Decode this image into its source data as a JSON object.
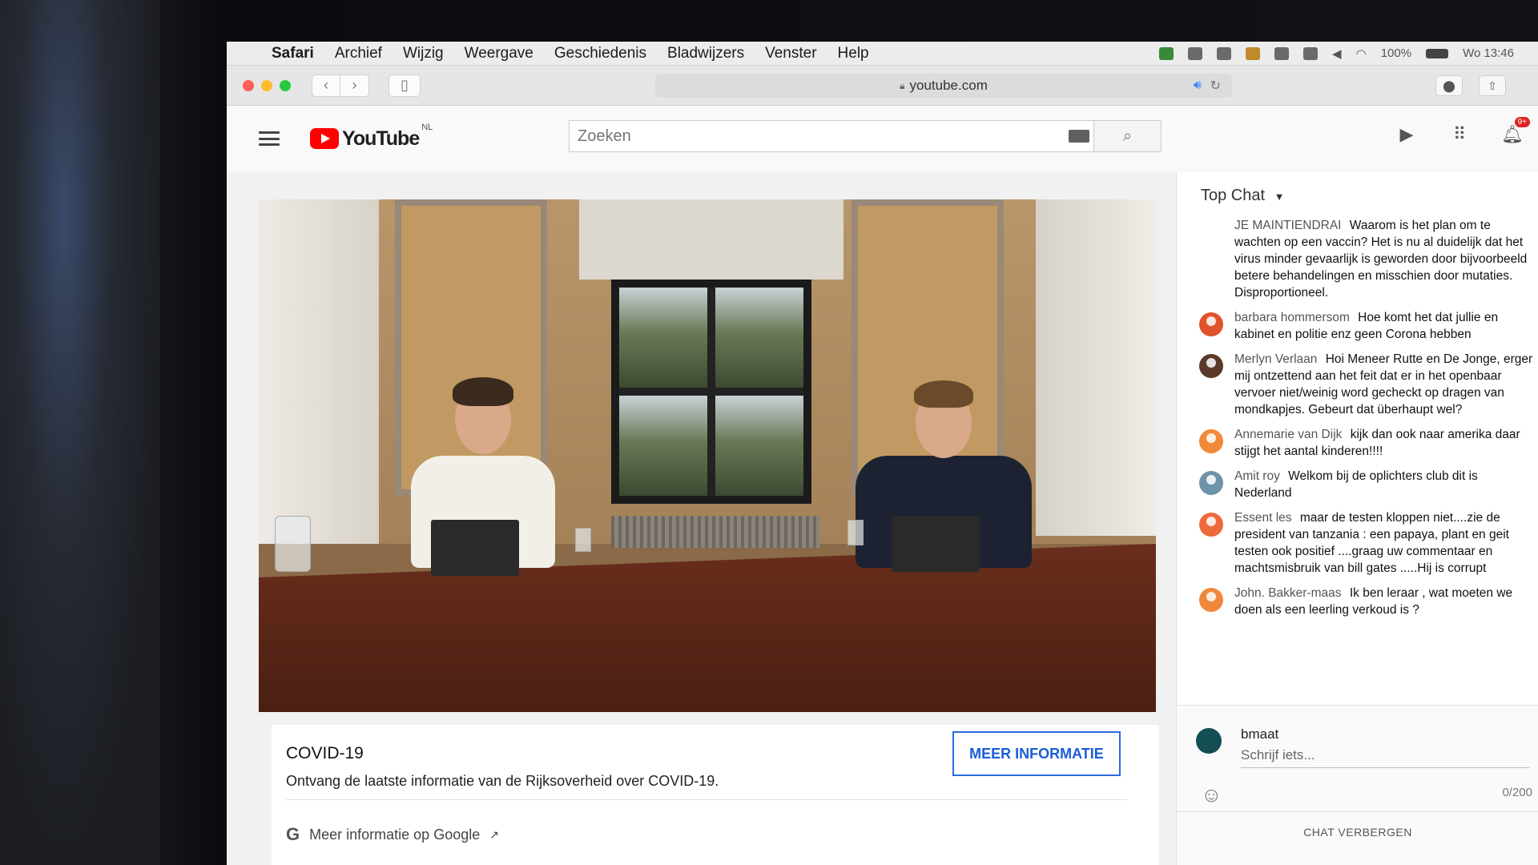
{
  "menubar": {
    "app": "Safari",
    "items": [
      "Archief",
      "Wijzig",
      "Weergave",
      "Geschiedenis",
      "Bladwijzers",
      "Venster",
      "Help"
    ],
    "battery": "100%",
    "clock": "Wo 13:46"
  },
  "toolbar": {
    "url": "youtube.com"
  },
  "youtube": {
    "logo_text": "YouTube",
    "region": "NL",
    "search_placeholder": "Zoeken",
    "notification_count": "9+"
  },
  "info_card": {
    "title": "COVID-19",
    "description": "Ontvang de laatste informatie van de Rijksoverheid over COVID-19.",
    "button_label": "MEER INFORMATIE",
    "google_link": "Meer informatie op Google"
  },
  "chat": {
    "header": "Top Chat",
    "messages": [
      {
        "author": "JE MAINTIENDRAI",
        "text": "Waarom is het plan om te wachten op een vaccin? Het is nu al duidelijk dat het virus minder gevaarlijk is geworden door bijvoorbeeld betere behandelingen en misschien door mutaties. Disproportioneel.",
        "avatar_color": "#ffffff"
      },
      {
        "author": "barbara hommersom",
        "text": "Hoe komt het dat jullie en kabinet en politie enz geen Corona hebben",
        "avatar_color": "#e0532c"
      },
      {
        "author": "Merlyn Verlaan",
        "text": "Hoi Meneer Rutte en De Jonge, erger mij ontzettend aan het feit dat er in het openbaar vervoer niet/weinig word gecheckt op dragen van mondkapjes. Gebeurt dat überhaupt wel?",
        "avatar_color": "#5a3a28"
      },
      {
        "author": "Annemarie van Dijk",
        "text": "kijk dan ook naar amerika daar stijgt het aantal kinderen!!!!",
        "avatar_color": "#f08a3a"
      },
      {
        "author": "Amit roy",
        "text": "Welkom bij de oplichters club dit is Nederland",
        "avatar_color": "#6f93a8"
      },
      {
        "author": "Essent les",
        "text": "maar de testen kloppen niet....zie de president van tanzania : een papaya, plant en geit testen ook positief ....graag uw commentaar en machtsmisbruik van bill gates .....Hij is corrupt",
        "avatar_color": "#ee6a3a"
      },
      {
        "author": "John. Bakker-maas",
        "text": "Ik ben leraar , wat moeten we doen als een leerling verkoud is ?",
        "avatar_color": "#f0883a"
      }
    ],
    "current_user": "bmaat",
    "input_placeholder": "Schrijf iets...",
    "char_counter": "0/200",
    "hide_label": "CHAT VERBERGEN"
  },
  "colors": {
    "youtube_red": "#ff0000",
    "link_blue": "#1a5cd8",
    "close_light": "#fe5f57",
    "minimize_light": "#febc2e",
    "zoom_light": "#28c840"
  }
}
